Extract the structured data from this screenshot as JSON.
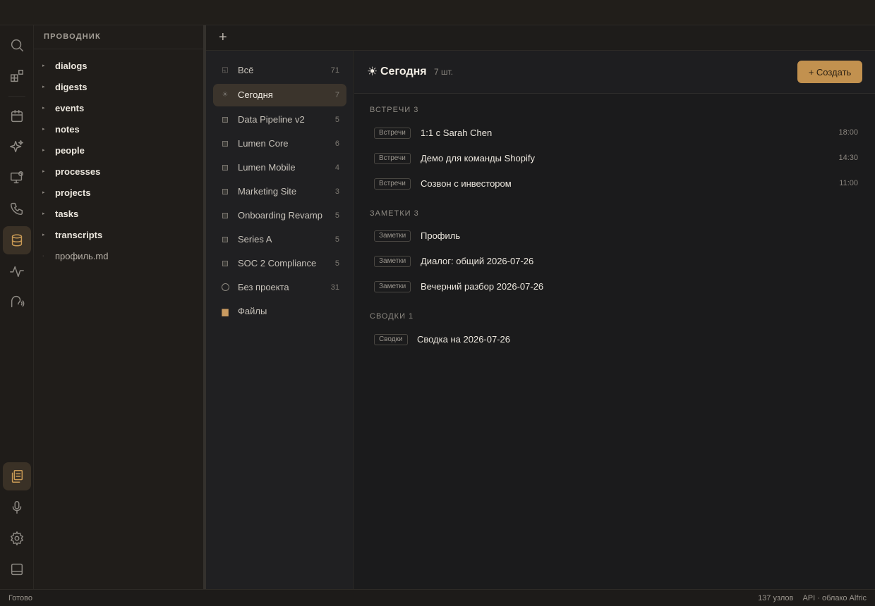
{
  "explorer": {
    "title": "ПРОВОДНИК",
    "items": [
      {
        "label": "dialogs",
        "type": "folder"
      },
      {
        "label": "digests",
        "type": "folder"
      },
      {
        "label": "events",
        "type": "folder"
      },
      {
        "label": "notes",
        "type": "folder"
      },
      {
        "label": "people",
        "type": "folder"
      },
      {
        "label": "processes",
        "type": "folder"
      },
      {
        "label": "projects",
        "type": "folder"
      },
      {
        "label": "tasks",
        "type": "folder"
      },
      {
        "label": "transcripts",
        "type": "folder"
      },
      {
        "label": "профиль.md",
        "type": "file"
      }
    ]
  },
  "tabs": {
    "add_label": "+"
  },
  "projects": [
    {
      "name": "Всё",
      "count": "71",
      "icon": "all-icon"
    },
    {
      "name": "Сегодня",
      "count": "7",
      "icon": "sun-icon",
      "selected": true
    },
    {
      "name": "Data Pipeline v2",
      "count": "5",
      "icon": "project-square-icon"
    },
    {
      "name": "Lumen Core",
      "count": "6",
      "icon": "project-square-icon"
    },
    {
      "name": "Lumen Mobile",
      "count": "4",
      "icon": "project-square-icon"
    },
    {
      "name": "Marketing Site",
      "count": "3",
      "icon": "project-square-icon"
    },
    {
      "name": "Onboarding Revamp",
      "count": "5",
      "icon": "project-square-icon"
    },
    {
      "name": "Series A",
      "count": "5",
      "icon": "project-square-icon"
    },
    {
      "name": "SOC 2 Compliance",
      "count": "5",
      "icon": "project-square-icon"
    },
    {
      "name": "Без проекта",
      "count": "31",
      "icon": "circle-icon"
    },
    {
      "name": "Файлы",
      "count": "",
      "icon": "folder-icon"
    }
  ],
  "main": {
    "icon": "☀",
    "title": "Сегодня",
    "count": "7 шт.",
    "create_label": "+ Создать",
    "sections": [
      {
        "title": "ВСТРЕЧИ 3",
        "rows": [
          {
            "badge": "Встречи",
            "title": "1:1 с Sarah Chen",
            "time": "18:00"
          },
          {
            "badge": "Встречи",
            "title": "Демо для команды Shopify",
            "time": "14:30"
          },
          {
            "badge": "Встречи",
            "title": "Созвон с инвестором",
            "time": "11:00"
          }
        ]
      },
      {
        "title": "ЗАМЕТКИ 3",
        "rows": [
          {
            "badge": "Заметки",
            "title": "Профиль",
            "time": ""
          },
          {
            "badge": "Заметки",
            "title": "Диалог: общий 2026-07-26",
            "time": ""
          },
          {
            "badge": "Заметки",
            "title": "Вечерний разбор 2026-07-26",
            "time": ""
          }
        ]
      },
      {
        "title": "СВОДКИ 1",
        "rows": [
          {
            "badge": "Сводки",
            "title": "Сводка на 2026-07-26",
            "time": ""
          }
        ]
      }
    ]
  },
  "status": {
    "left": "Готово",
    "nodes": "137 узлов",
    "api": "API · облако Alfric"
  },
  "colors": {
    "accent": "#c2914f",
    "selected_bg": "#3b342c",
    "background": "#1b1a19"
  }
}
